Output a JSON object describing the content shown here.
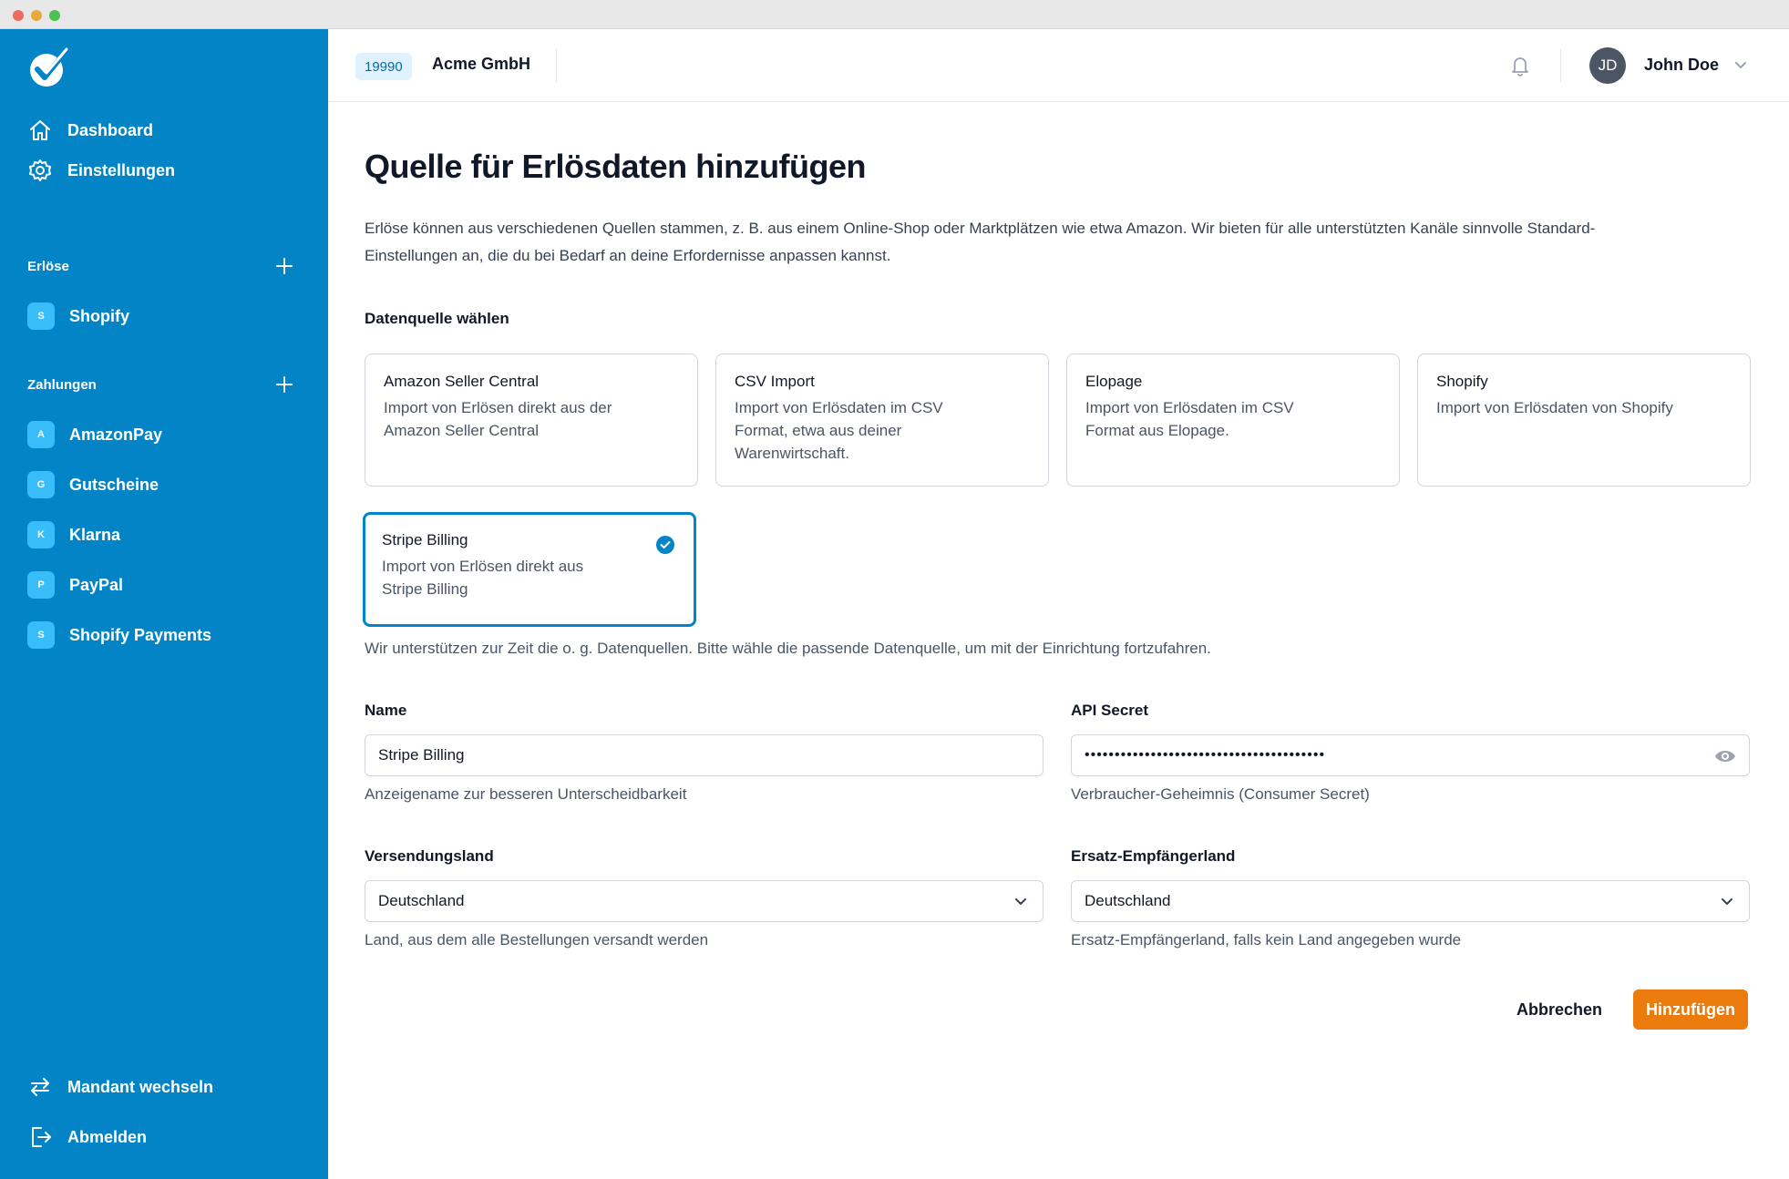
{
  "sidebar": {
    "nav": [
      {
        "label": "Dashboard",
        "icon": "home-icon"
      },
      {
        "label": "Einstellungen",
        "icon": "gear-icon"
      }
    ],
    "revenue_section": {
      "label": "Erlöse",
      "items": [
        {
          "badge": "S",
          "label": "Shopify"
        }
      ]
    },
    "payments_section": {
      "label": "Zahlungen",
      "items": [
        {
          "badge": "A",
          "label": "AmazonPay"
        },
        {
          "badge": "G",
          "label": "Gutscheine"
        },
        {
          "badge": "K",
          "label": "Klarna"
        },
        {
          "badge": "P",
          "label": "PayPal"
        },
        {
          "badge": "S",
          "label": "Shopify Payments"
        }
      ]
    },
    "footer": [
      {
        "label": "Mandant wechseln",
        "icon": "switch-arrows-icon"
      },
      {
        "label": "Abmelden",
        "icon": "logout-icon"
      }
    ]
  },
  "header": {
    "tenant_id": "19990",
    "tenant_name": "Acme GmbH",
    "user_initials": "JD",
    "user_name": "John Doe"
  },
  "main": {
    "title": "Quelle für Erlösdaten hinzufügen",
    "intro_line1": "Erlöse können aus verschiedenen Quellen stammen, z. B. aus einem Online-Shop oder Marktplätzen wie etwa Amazon. Wir bieten für alle unterstützten Kanäle sinnvolle Standard-",
    "intro_line2": "Einstellungen an, die du bei Bedarf an deine Erfordernisse anpassen kannst.",
    "source_label": "Datenquelle wählen",
    "sources": [
      {
        "title": "Amazon Seller Central",
        "desc_lines": [
          "Import von Erlösen direkt aus der",
          "Amazon Seller Central"
        ],
        "selected": false
      },
      {
        "title": "CSV Import",
        "desc_lines": [
          "Import von Erlösdaten im CSV",
          "Format, etwa aus deiner",
          "Warenwirtschaft."
        ],
        "selected": false
      },
      {
        "title": "Elopage",
        "desc_lines": [
          "Import von Erlösdaten im CSV",
          "Format aus Elopage."
        ],
        "selected": false
      },
      {
        "title": "Shopify",
        "desc_lines": [
          "Import von Erlösdaten von Shopify"
        ],
        "selected": false
      },
      {
        "title": "Stripe Billing",
        "desc_lines": [
          "Import von Erlösen direkt aus",
          "Stripe Billing"
        ],
        "selected": true
      }
    ],
    "source_hint": "Wir unterstützen zur Zeit die o. g. Datenquellen. Bitte wähle die passende Datenquelle, um mit der Einrichtung fortzufahren.",
    "form": {
      "name": {
        "label": "Name",
        "value": "Stripe Billing",
        "hint": "Anzeigename zur besseren Unterscheidbarkeit"
      },
      "api_secret": {
        "label": "API Secret",
        "value": "••••••••••••••••••••••••••••••••••••••••",
        "hint": "Verbraucher-Geheimnis (Consumer Secret)"
      },
      "shipping_country": {
        "label": "Versendungsland",
        "value": "Deutschland",
        "hint": "Land, aus dem alle Bestellungen versandt werden"
      },
      "fallback_country": {
        "label": "Ersatz-Empfängerland",
        "value": "Deutschland",
        "hint": "Ersatz-Empfängerland, falls kein Land angegeben wurde"
      }
    },
    "actions": {
      "cancel": "Abbrechen",
      "submit": "Hinzufügen"
    }
  },
  "colors": {
    "sidebar": "#0284c7",
    "accent": "#0284c7",
    "primary_button": "#ea7b0c",
    "badge": "#38bdf8"
  }
}
